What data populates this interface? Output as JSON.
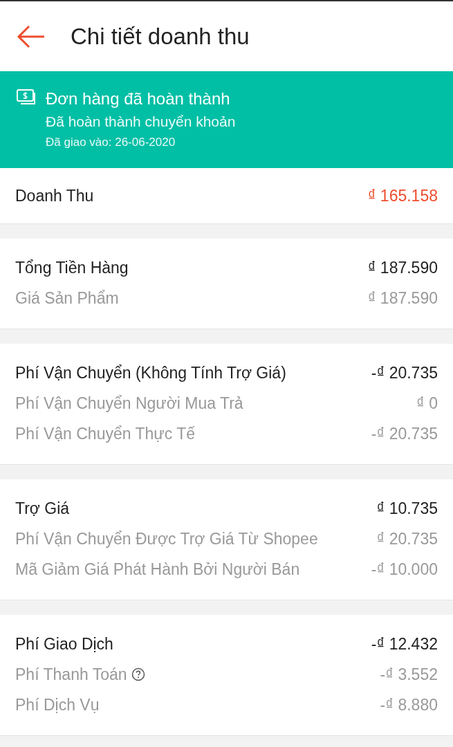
{
  "header": {
    "title": "Chi tiết doanh thu"
  },
  "banner": {
    "title": "Đơn hàng đã hoàn thành",
    "subtitle": "Đã hoàn thành chuyển khoản",
    "date": "Đã giao vào: 26-06-2020"
  },
  "sections": [
    {
      "rows": [
        {
          "kind": "revenue",
          "label": "Doanh Thu",
          "amount": "₫ 165.158"
        }
      ]
    },
    {
      "rows": [
        {
          "kind": "total",
          "label": "Tổng Tiền Hàng",
          "amount": "₫ 187.590"
        },
        {
          "kind": "detail",
          "label": "Giá Sản Phẩm",
          "amount": "₫ 187.590"
        }
      ]
    },
    {
      "rows": [
        {
          "kind": "total",
          "label": "Phí Vận Chuyển (Không Tính Trợ Giá)",
          "amount": "-₫ 20.735"
        },
        {
          "kind": "detail",
          "label": "Phí Vận Chuyển Người Mua Trả",
          "amount": "₫ 0"
        },
        {
          "kind": "detail",
          "label": "Phí Vận Chuyển Thực Tế",
          "amount": "-₫ 20.735"
        }
      ]
    },
    {
      "rows": [
        {
          "kind": "total",
          "label": "Trợ Giá",
          "amount": "₫ 10.735"
        },
        {
          "kind": "detail",
          "label": "Phí Vận Chuyển Được Trợ Giá Từ Shopee",
          "amount": "₫ 20.735"
        },
        {
          "kind": "detail",
          "label": "Mã Giảm Giá Phát Hành Bởi Người Bán",
          "amount": "-₫ 10.000"
        }
      ]
    },
    {
      "rows": [
        {
          "kind": "total",
          "label": "Phí Giao Dịch",
          "amount": "-₫ 12.432"
        },
        {
          "kind": "detail",
          "label": "Phí Thanh Toán",
          "amount": "-₫ 3.552",
          "help": true
        },
        {
          "kind": "detail",
          "label": "Phí Dịch Vụ",
          "amount": "-₫ 8.880"
        }
      ]
    }
  ]
}
